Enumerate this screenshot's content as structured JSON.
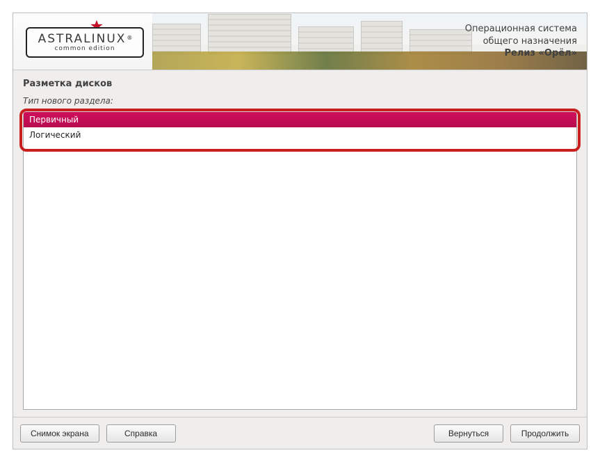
{
  "branding": {
    "logo_name": "ASTRALINUX",
    "logo_subtitle": "common edition",
    "os_line1": "Операционная система",
    "os_line2": "общего назначения",
    "release": "Релиз «Орёл»"
  },
  "page": {
    "title": "Разметка дисков",
    "prompt": "Тип нового раздела:"
  },
  "options": [
    {
      "label": "Первичный",
      "selected": true
    },
    {
      "label": "Логический",
      "selected": false
    }
  ],
  "buttons": {
    "screenshot": "Снимок экрана",
    "help": "Справка",
    "back": "Вернуться",
    "next": "Продолжить"
  }
}
